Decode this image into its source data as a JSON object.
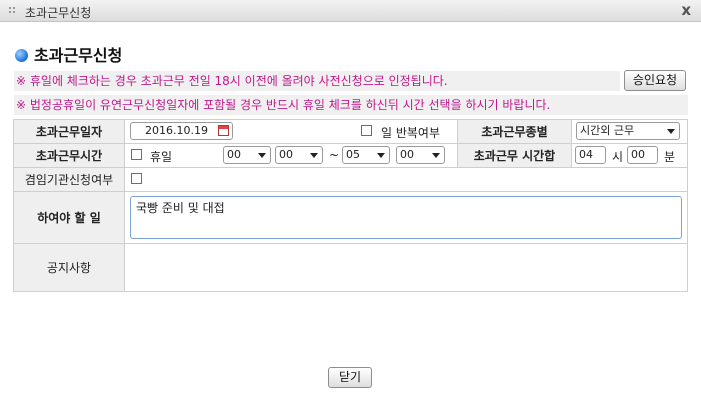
{
  "window": {
    "title": "초과근무신청",
    "close": "x"
  },
  "heading": "초과근무신청",
  "notices": [
    "※ 휴일에 체크하는 경우 초과근무 전일 18시 이전에 올려야 사전신청으로 인정됩니다.",
    "※ 법정공휴일이 유연근무신청일자에 포함될 경우 반드시 휴일 체크를 하신뒤 시간 선택을 하시기 바랍니다."
  ],
  "approve_button": "승인요청",
  "form": {
    "date_label": "초과근무일자",
    "date_value": "2016.10.19",
    "repeat_label": "일 반복여부",
    "type_label": "초과근무종별",
    "type_value": "시간외 근무",
    "time_label": "초과근무시간",
    "holiday_label": "휴일",
    "start_hour": "00",
    "start_min": "00",
    "tilde": "~",
    "end_hour": "05",
    "end_min": "00",
    "total_label": "초과근무 시간합",
    "total_hours": "04",
    "hour_unit": "시",
    "total_minutes": "00",
    "minute_unit": "분",
    "concurrent_label": "겸임기관신청여부",
    "todo_label": "하여야 할 일",
    "todo_value": "국빵 준비 및 대접",
    "notice_label": "공지사항"
  },
  "close_button": "닫기"
}
